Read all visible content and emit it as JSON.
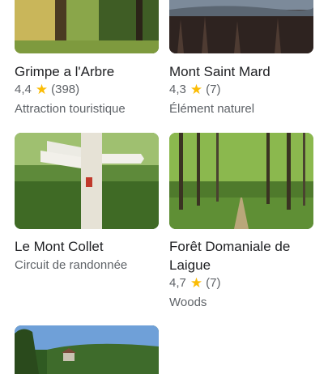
{
  "places": [
    {
      "name": "Grimpe a l'Arbre",
      "rating": "4,4",
      "reviews": "(398)",
      "category": "Attraction touristique",
      "image": "treehouse-photo"
    },
    {
      "name": "Mont Saint Mard",
      "rating": "4,3",
      "reviews": "(7)",
      "category": "Élément naturel",
      "image": "hill-view-photo"
    },
    {
      "name": "Le Mont Collet",
      "category": "Circuit de randonnée",
      "image": "signpost-photo"
    },
    {
      "name_line1": "Forêt Domaniale de",
      "name_line2": "Laigue",
      "rating": "4,7",
      "reviews": "(7)",
      "category": "Woods",
      "image": "forest-path-photo"
    },
    {
      "image": "village-landscape-photo"
    }
  ],
  "icons": {
    "star": "star-icon"
  },
  "colors": {
    "star": "#fbbc04",
    "secondary_text": "#5f6368",
    "primary_text": "#202124"
  }
}
